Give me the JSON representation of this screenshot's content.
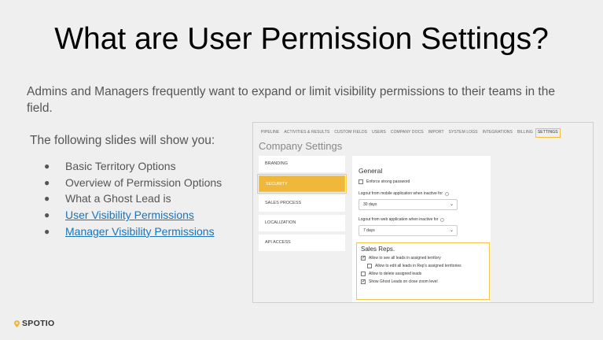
{
  "slide": {
    "title": "What are User Permission Settings?",
    "intro": "Admins and Managers frequently want to expand or limit visibility permissions to their teams in the field.",
    "lead": "The following slides will show you:",
    "bullets": [
      {
        "text": "Basic Territory Options",
        "link": false
      },
      {
        "text": "Overview of Permission Options",
        "link": false
      },
      {
        "text": "What a Ghost Lead is",
        "link": false
      },
      {
        "text": "User Visibility Permissions",
        "link": true
      },
      {
        "text": "Manager Visibility Permissions",
        "link": true
      }
    ],
    "logo": "SPOTIO"
  },
  "screenshot": {
    "nav": [
      "PIPELINE",
      "ACTIVITIES & RESULTS",
      "CUSTOM FIELDS",
      "USERS",
      "COMPANY DOCS",
      "IMPORT",
      "SYSTEM LOGS",
      "INTEGRATIONS",
      "BILLING",
      "SETTINGS"
    ],
    "nav_active": "SETTINGS",
    "page_title": "Company Settings",
    "sidebar": [
      "BRANDING",
      "SECURITY",
      "SALES PROCESS",
      "LOCALIZATION",
      "API ACCESS"
    ],
    "sidebar_active": "SECURITY",
    "general": {
      "heading": "General",
      "enforce_password": "Enforce strong password",
      "mobile_label": "Logout from mobile application when inactive for",
      "mobile_value": "30 days",
      "web_label": "Logout from web application when inactive for",
      "web_value": "7 days"
    },
    "sales_reps": {
      "heading": "Sales Reps.",
      "options": [
        {
          "label": "Allow to see all leads in assigned territory",
          "checked": true,
          "indent": false
        },
        {
          "label": "Allow to edit all leads in Rep's assigned territories",
          "checked": false,
          "indent": true
        },
        {
          "label": "Allow to delete assigned leads",
          "checked": false,
          "indent": false
        },
        {
          "label": "Show Ghost Leads on close zoom level",
          "checked": true,
          "indent": false
        }
      ]
    }
  },
  "colors": {
    "accent": "#f0b83a",
    "link": "#1a73b8",
    "background": "#efefef"
  }
}
